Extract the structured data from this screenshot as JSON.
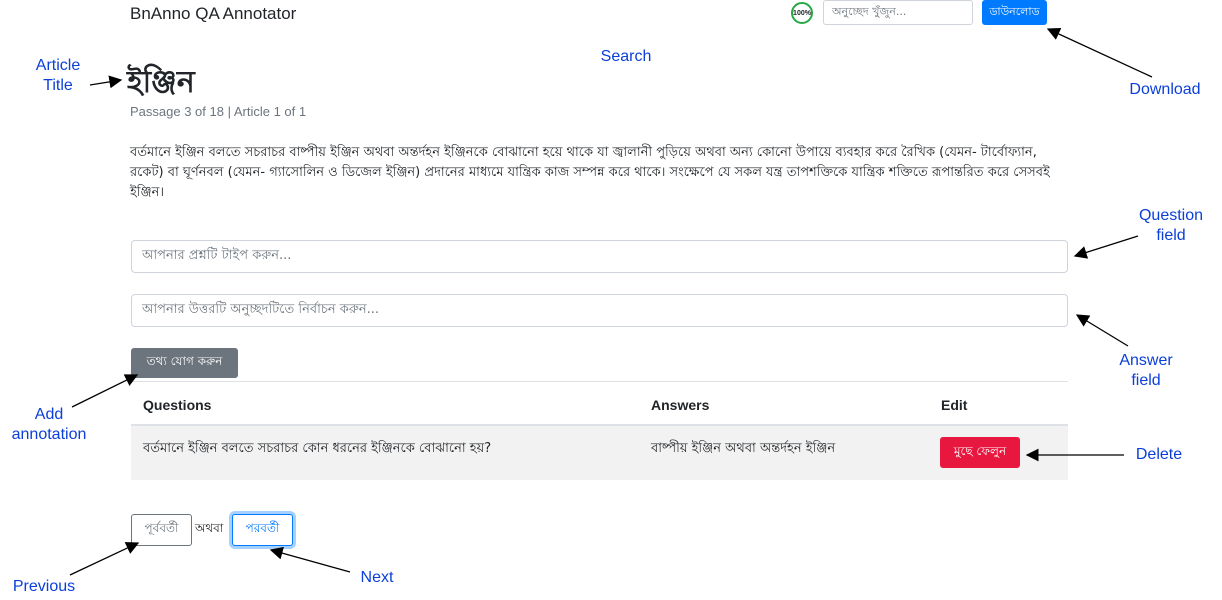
{
  "header": {
    "app_title": "BnAnno QA Annotator",
    "progress_label": "100%",
    "search_placeholder": "অনুচ্ছেদ খুঁজুন...",
    "download_label": "ডাউনলোড"
  },
  "article": {
    "title": "ইঞ্জিন",
    "meta": "Passage 3 of 18 | Article 1 of 1",
    "passage": "বর্তমানে ইঞ্জিন বলতে সচরাচর বাষ্পীয় ইঞ্জিন অথবা অন্তর্দহন ইঞ্জিনকে বোঝানো হয়ে থাকে যা জ্বালানী পুড়িয়ে অথবা অন্য কোনো উপায়ে ব্যবহার করে রৈখিক (যেমন- টার্বোফ্যান, রকেট) বা ঘূর্ণনবল (যেমন- গ্যাসোলিন ও ডিজেল ইঞ্জিন) প্রদানের মাধ্যমে যান্ত্রিক কাজ সম্পন্ন করে থাকে। সংক্ষেপে যে সকল যন্ত্র তাপশক্তিকে যান্ত্রিক শক্তিতে রূপান্তরিত করে সেসবই ইঞ্জিন।"
  },
  "form": {
    "question_placeholder": "আপনার প্রশ্নটি টাইপ করুন...",
    "answer_placeholder": "আপনার উত্তরটি অনুচ্ছদটিতে নির্বাচন করুন...",
    "add_label": "তথ্য যোগ করুন"
  },
  "table": {
    "headers": [
      "Questions",
      "Answers",
      "Edit"
    ],
    "rows": [
      {
        "question": "বর্তমানে ইঞ্জিন বলতে সচরাচর কোন ধরনের ইঞ্জিনকে বোঝানো হয়?",
        "answer": "বাষ্পীয় ইঞ্জিন অথবা অন্তর্দহন ইঞ্জিন",
        "delete_label": "মুছে ফেলুন"
      }
    ]
  },
  "pagination": {
    "prev_label": "পূর্ববর্তী",
    "or_label": "অথবা",
    "next_label": "পরবর্তী"
  },
  "annotations": {
    "article_title": [
      "Article",
      "Title"
    ],
    "search": "Search",
    "download": "Download",
    "question_field": [
      "Question",
      "field"
    ],
    "answer_field": [
      "Answer",
      "field"
    ],
    "add_annotation": [
      "Add",
      "annotation"
    ],
    "delete": "Delete",
    "previous": "Previous",
    "next": "Next"
  },
  "colors": {
    "primary": "#007bff",
    "secondary": "#6c757d",
    "danger": "#e8173f",
    "success": "#28a745",
    "annotation": "#0b3fd8"
  }
}
